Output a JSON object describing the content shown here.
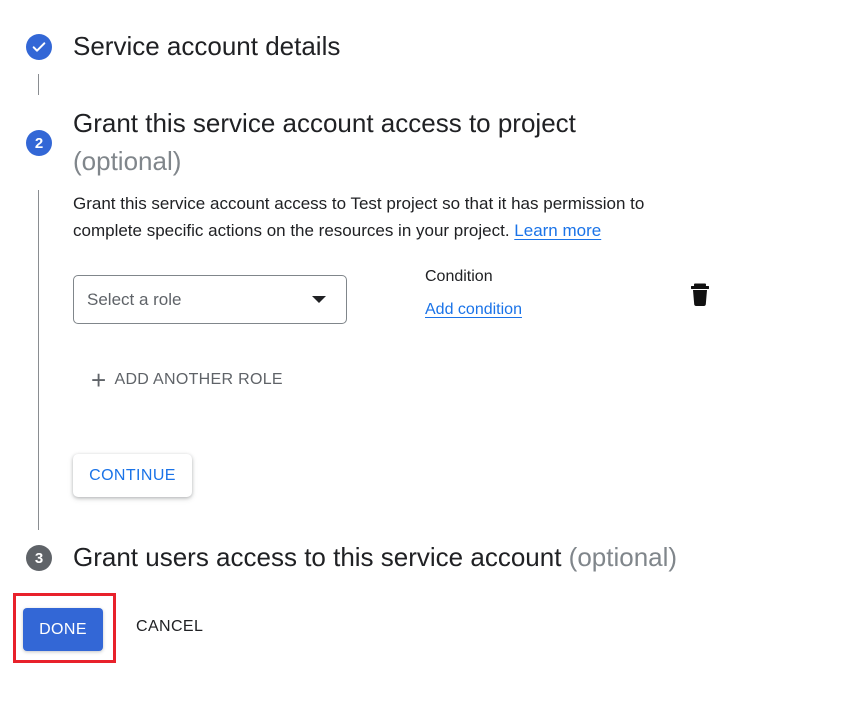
{
  "steps": {
    "step1": {
      "title": "Service account details",
      "status": "completed",
      "icon": "check-icon"
    },
    "step2": {
      "number": "2",
      "title": "Grant this service account access to project",
      "optional": "(optional)",
      "description": "Grant this service account access to Test project so that it has permission to complete specific actions on the resources in your project.",
      "learn_more": "Learn more",
      "role_select": {
        "placeholder": "Select a role"
      },
      "condition": {
        "label": "Condition",
        "add_link": "Add condition"
      },
      "add_another_role": "ADD ANOTHER ROLE",
      "continue_label": "CONTINUE"
    },
    "step3": {
      "number": "3",
      "title": "Grant users access to this service account",
      "optional": "(optional)"
    }
  },
  "actions": {
    "done_label": "DONE",
    "cancel_label": "CANCEL"
  },
  "colors": {
    "accent": "#3367d6",
    "link": "#1a73e8",
    "inactive_step": "#5f6368",
    "highlight": "#e8212b"
  }
}
